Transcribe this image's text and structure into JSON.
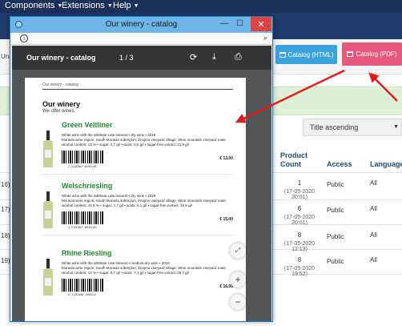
{
  "topmenu": [
    {
      "label": "Components"
    },
    {
      "label": "Extensions"
    },
    {
      "label": "Help"
    }
  ],
  "background": {
    "left_label": "Ung",
    "buttons": {
      "html": "Catalog (HTML)",
      "pdf": "Catalog (PDF)"
    },
    "sort_select": "Title ascending",
    "columns": {
      "count_line1": "Product",
      "count_line2": "Count",
      "access": "Access",
      "language": "Language"
    },
    "rows": [
      {
        "left": "16)",
        "count": "1",
        "date": "(17-05-2020 20:01)",
        "access": "Public",
        "language": "All"
      },
      {
        "left": "17)",
        "count": "6",
        "date": "(17-05-2020 20:01)",
        "access": "Public",
        "language": "All"
      },
      {
        "left": "18)",
        "count": "8",
        "date": "(17-05-2020 12:13)",
        "access": "Public",
        "language": "All"
      },
      {
        "left": "19)",
        "count": "8",
        "date": "(17-05-2020 19:52)",
        "access": "Public",
        "language": "All"
      }
    ]
  },
  "window": {
    "title": "Our winery - catalog",
    "minimize": "—",
    "maximize": "☐",
    "close": "✕"
  },
  "viewer": {
    "doc_title": "Our winery - catalog",
    "page_indicator": "1 / 3",
    "icons": [
      "rotate-icon",
      "download-icon",
      "print-icon"
    ]
  },
  "pdf": {
    "header_small": "Our winery - catalog",
    "title": "Our winery",
    "subtitle": "We offer wines",
    "wines": [
      {
        "name": "Green Veltliner",
        "line1": "White wine with the attribute Late harvest • dry wine • 2019",
        "line2": "Moravia wine region, South Moravia subregion, Znojmo vineyard village, Wine mountain vineyard route",
        "line3": "alcohol content: 13 % • sugar: 2,7 g/l • acids: 5,6 g/l • sugar-free extract: 21,9 g/l",
        "barcode": "1 234567 890128",
        "price": "€ 13,00"
      },
      {
        "name": "Welschriesling",
        "line1": "White wine with the attribute Late harvest • dry wine • 2019",
        "line2": "Moravia wine region, South Moravia subregion, Znojmo vineyard village, Wine mountain vineyard route",
        "line3": "alcohol content: 12,5 % • sugar: 1,7 g/l • acids: 6,1 g/l • sugar-free extract: 19,9 g/l",
        "barcode": "1 234567 894140",
        "price": "€ 15,00"
      },
      {
        "name": "Rhine Riesling",
        "line1": "White wine with the attribute Late harvest • medium-dry wine • 2019",
        "line2": "Moravia wine region, South Moravia subregion, Znojmo vineyard village, Wine mountain vineyard route",
        "line3": "alcohol content: 12 % • sugar: 8,7 g/l • acids: 7,1 g/l • sugar-free extract: 25,7 g/l",
        "barcode": "0 123456 789012",
        "price": "€ 16,00"
      }
    ]
  },
  "colors": {
    "topbar": "#1b3159",
    "html_button": "#3aa3dc",
    "pdf_button": "#e8587c",
    "wine_name": "#1f8a2e",
    "arrow": "#e31b1b"
  }
}
